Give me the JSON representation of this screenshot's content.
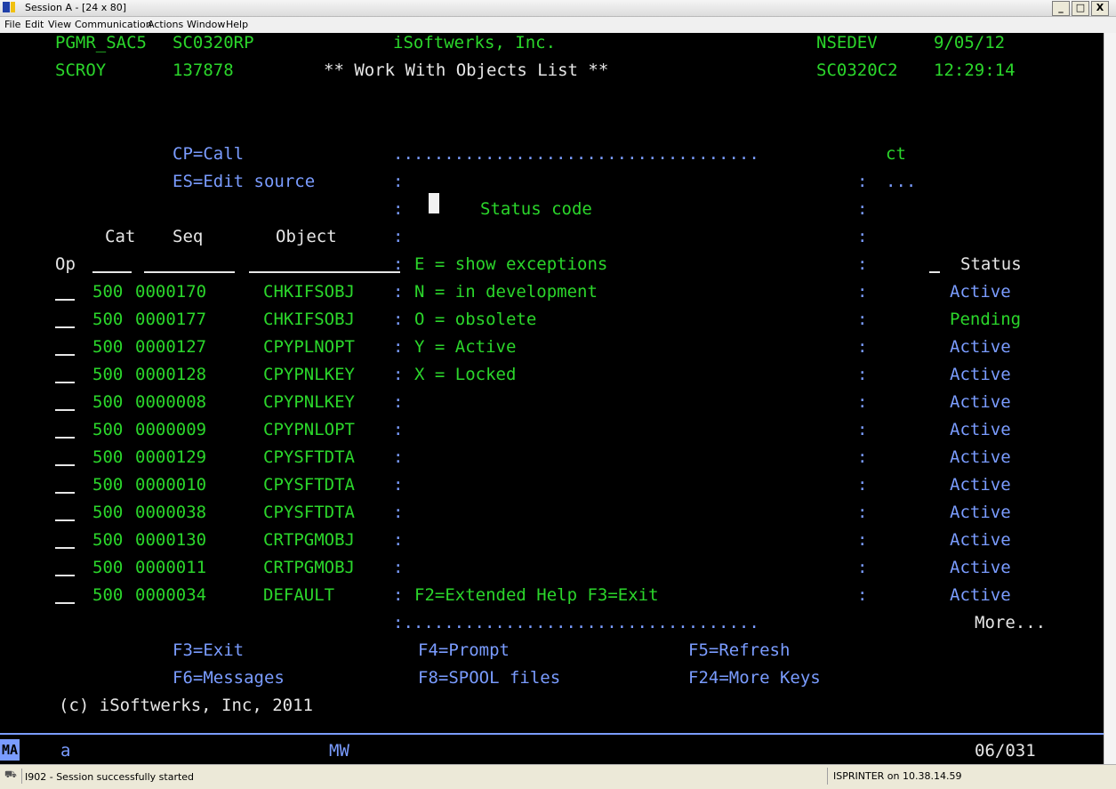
{
  "window": {
    "title": "Session A - [24 x 80]",
    "minimize": "_",
    "maximize": "□",
    "close": "X"
  },
  "menu": {
    "file": "File",
    "edit": "Edit",
    "view": "View",
    "communication": "Communication",
    "actions": "Actions",
    "window": "Window",
    "help": "Help"
  },
  "header": {
    "user": "PGMR_SAC5",
    "program": "SC0320RP",
    "company": "iSoftwerks, Inc.",
    "system": "NSEDEV",
    "date": "9/05/12",
    "user2": "SCROY",
    "job": "137878",
    "screen_title": "** Work With Objects List **",
    "format": "SC0320C2",
    "time": "12:29:14"
  },
  "options": {
    "cp": "CP=Call",
    "es": "ES=Edit source",
    "ct": "ct",
    "ellipsis": "..."
  },
  "columns": {
    "cat": "Cat",
    "seq": "Seq",
    "object": "Object",
    "op": "Op",
    "status": "Status"
  },
  "popup": {
    "top_border": "....................................",
    "title": "Status code",
    "help_line": "F2=Extended Help F3=Exit",
    "bottom_border": ":...................................",
    "codes": [
      "E = show exceptions",
      "N = in development",
      "O = obsolete",
      "Y = Active",
      "X = Locked"
    ]
  },
  "rows": [
    {
      "cat": "500",
      "seq": "0000170",
      "object": "CHKIFSOBJ",
      "status": "Active"
    },
    {
      "cat": "500",
      "seq": "0000177",
      "object": "CHKIFSOBJ",
      "status": "Pending"
    },
    {
      "cat": "500",
      "seq": "0000127",
      "object": "CPYPLNOPT",
      "status": "Active"
    },
    {
      "cat": "500",
      "seq": "0000128",
      "object": "CPYPNLKEY",
      "status": "Active"
    },
    {
      "cat": "500",
      "seq": "0000008",
      "object": "CPYPNLKEY",
      "status": "Active"
    },
    {
      "cat": "500",
      "seq": "0000009",
      "object": "CPYPNLOPT",
      "status": "Active"
    },
    {
      "cat": "500",
      "seq": "0000129",
      "object": "CPYSFTDTA",
      "status": "Active"
    },
    {
      "cat": "500",
      "seq": "0000010",
      "object": "CPYSFTDTA",
      "status": "Active"
    },
    {
      "cat": "500",
      "seq": "0000038",
      "object": "CPYSFTDTA",
      "status": "Active"
    },
    {
      "cat": "500",
      "seq": "0000130",
      "object": "CRTPGMOBJ",
      "status": "Active"
    },
    {
      "cat": "500",
      "seq": "0000011",
      "object": "CRTPGMOBJ",
      "status": "Active"
    },
    {
      "cat": "500",
      "seq": "0000034",
      "object": "DEFAULT",
      "status": "Active"
    }
  ],
  "more": "More...",
  "fkeys": {
    "f3": "F3=Exit",
    "f4": "F4=Prompt",
    "f5": "F5=Refresh",
    "f6": "F6=Messages",
    "f8": "F8=SPOOL files",
    "f24": "F24=More Keys"
  },
  "copyright": "(c) iSoftwerks, Inc, 2011",
  "oia": {
    "mode": "MA",
    "input": "a",
    "mw": "MW",
    "cursor_pos": "06/031"
  },
  "statusbar": {
    "message": "I902 - Session successfully started",
    "printer": "ISPRINTER on 10.38.14.59"
  },
  "colors": {
    "green": "#2bd62b",
    "blue": "#7a9cff",
    "white": "#e6e6e6",
    "background": "#000000"
  }
}
